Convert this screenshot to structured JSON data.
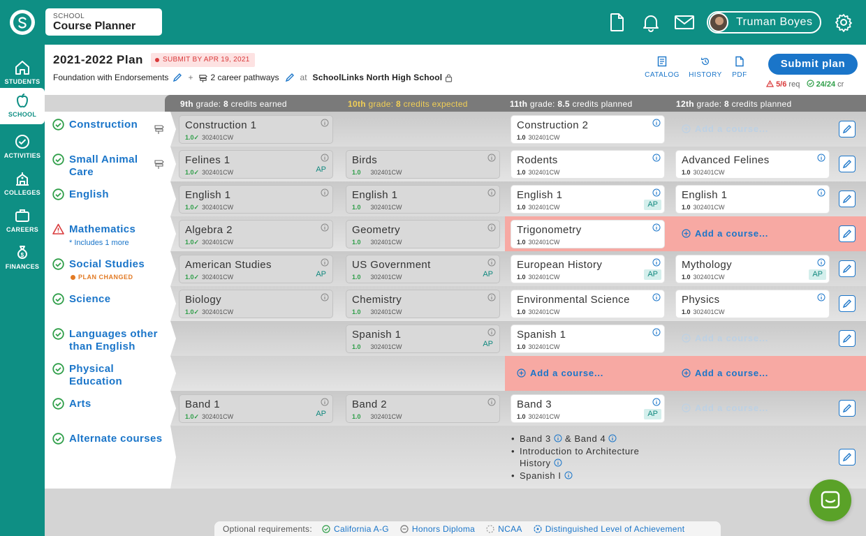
{
  "app": {
    "subtitle": "SCHOOL",
    "title": "Course Planner"
  },
  "user": {
    "name": "Truman Boyes"
  },
  "nav": [
    {
      "label": "STUDENTS",
      "icon": "home-icon"
    },
    {
      "label": "SCHOOL",
      "icon": "apple-icon",
      "active": true
    },
    {
      "label": "ACTIVITIES",
      "icon": "check-circle-icon"
    },
    {
      "label": "COLLEGES",
      "icon": "college-icon"
    },
    {
      "label": "CAREERS",
      "icon": "briefcase-icon"
    },
    {
      "label": "FINANCES",
      "icon": "money-bag-icon"
    }
  ],
  "plan": {
    "title": "2021-2022 Plan",
    "submit_by": "SUBMIT BY APR 19, 2021",
    "diploma": "Foundation with Endorsements",
    "plus": "+",
    "pathways": "2 career pathways",
    "at": "at",
    "school": "SchoolLinks North High School"
  },
  "actions": {
    "catalog": "CATALOG",
    "history": "HISTORY",
    "pdf": "PDF",
    "submit": "Submit plan"
  },
  "requirements": {
    "req_value": "5/6",
    "req_label": "req",
    "cr_value": "24/24",
    "cr_label": "cr"
  },
  "grades": [
    {
      "grade": "9th",
      "mid": " grade: ",
      "credits": "8",
      "status": " credits earned"
    },
    {
      "grade": "10th",
      "mid": " grade: ",
      "credits": "8",
      "status": " credits expected"
    },
    {
      "grade": "11th",
      "mid": " grade: ",
      "credits": "8.5",
      "status": " credits planned"
    },
    {
      "grade": "12th",
      "mid": " grade: ",
      "credits": "8",
      "status": " credits planned"
    }
  ],
  "add_course": "Add a course...",
  "subjects": {
    "construction": {
      "name": "Construction"
    },
    "animal": {
      "name": "Small Animal Care"
    },
    "english": {
      "name": "English"
    },
    "math": {
      "name": "Mathematics",
      "note": "* Includes 1 more"
    },
    "social": {
      "name": "Social Studies",
      "note": "PLAN CHANGED"
    },
    "science": {
      "name": "Science"
    },
    "lote": {
      "name": "Languages other than English"
    },
    "pe": {
      "name": "Physical Education"
    },
    "arts": {
      "name": "Arts"
    },
    "alt": {
      "name": "Alternate courses"
    }
  },
  "courses": {
    "construction1": {
      "title": "Construction 1",
      "credit": "1.0",
      "code": "302401CW"
    },
    "construction2": {
      "title": "Construction 2",
      "credit": "1.0",
      "code": "302401CW"
    },
    "felines1": {
      "title": "Felines 1",
      "credit": "1.0",
      "code": "302401CW",
      "badge": "AP"
    },
    "birds": {
      "title": "Birds",
      "credit": "1.0",
      "code": "302401CW"
    },
    "rodents": {
      "title": "Rodents",
      "credit": "1.0",
      "code": "302401CW"
    },
    "advfelines": {
      "title": "Advanced Felines",
      "credit": "1.0",
      "code": "302401CW"
    },
    "eng9": {
      "title": "English 1",
      "credit": "1.0",
      "code": "302401CW"
    },
    "eng10": {
      "title": "English 1",
      "credit": "1.0",
      "code": "302401CW"
    },
    "eng11": {
      "title": "English 1",
      "credit": "1.0",
      "code": "302401CW",
      "badge": "AP"
    },
    "eng12": {
      "title": "English 1",
      "credit": "1.0",
      "code": "302401CW"
    },
    "algebra2": {
      "title": "Algebra 2",
      "credit": "1.0",
      "code": "302401CW"
    },
    "geometry": {
      "title": "Geometry",
      "credit": "1.0",
      "code": "302401CW"
    },
    "trig": {
      "title": "Trigonometry",
      "credit": "1.0",
      "code": "302401CW"
    },
    "amstudies": {
      "title": "American Studies",
      "credit": "1.0",
      "code": "302401CW",
      "badge": "AP"
    },
    "usgov": {
      "title": "US Government",
      "credit": "1.0",
      "code": "302401CW",
      "badge": "AP"
    },
    "euhist": {
      "title": "European History",
      "credit": "1.0",
      "code": "302401CW",
      "badge": "AP"
    },
    "mythology": {
      "title": "Mythology",
      "credit": "1.0",
      "code": "302401CW",
      "badge": "AP"
    },
    "biology": {
      "title": "Biology",
      "credit": "1.0",
      "code": "302401CW"
    },
    "chemistry": {
      "title": "Chemistry",
      "credit": "1.0",
      "code": "302401CW"
    },
    "envsci": {
      "title": "Environmental Science",
      "credit": "1.0",
      "code": "302401CW"
    },
    "physics": {
      "title": "Physics",
      "credit": "1.0",
      "code": "302401CW"
    },
    "spanish10": {
      "title": "Spanish 1",
      "credit": "1.0",
      "code": "302401CW",
      "badge": "AP"
    },
    "spanish11": {
      "title": "Spanish 1",
      "credit": "1.0",
      "code": "302401CW"
    },
    "band1": {
      "title": "Band 1",
      "credit": "1.0",
      "code": "302401CW",
      "badge": "AP"
    },
    "band2": {
      "title": "Band 2",
      "credit": "1.0",
      "code": "302401CW"
    },
    "band3": {
      "title": "Band 3",
      "credit": "1.0",
      "code": "302401CW",
      "badge": "AP"
    }
  },
  "alternates": {
    "a1": "Band 3",
    "a1_amp": "&",
    "a1_b": "Band 4",
    "a2": "Introduction to Architecture History",
    "a3": "Spanish I"
  },
  "legend": {
    "label": "Optional requirements:",
    "items": [
      "California A-G",
      "Honors Diploma",
      "NCAA",
      "Distinguished Level of Achievement"
    ]
  },
  "colors": {
    "teal": "#0e8f84",
    "blue": "#1a75c9",
    "red": "#d9393a",
    "green": "#2e9e48",
    "pink": "#f7a9a3",
    "chat": "#5aa228"
  }
}
